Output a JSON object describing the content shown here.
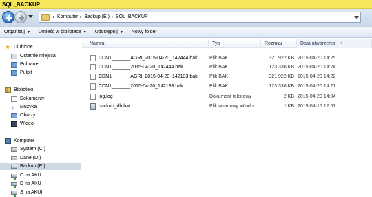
{
  "window": {
    "title": "SQL_BACKUP"
  },
  "address": {
    "crumbs": [
      "Komputer",
      "Backup (E:)",
      "SQL_BACKUP"
    ]
  },
  "toolbar": {
    "organize": "Organizuj",
    "share_library": "Umieść w bibliotece",
    "share": "Udostępnij",
    "new_folder": "Nowy folder"
  },
  "sidebar": {
    "favorites": "Ulubione",
    "recent": "Ostatnie miejsca",
    "downloads": "Pobrane",
    "desktop": "Pulpit",
    "libraries": "Biblioteki",
    "documents": "Dokumenty",
    "music": "Muzyka",
    "pictures": "Obrazy",
    "videos": "Wideo",
    "computer": "Komputer",
    "drives": [
      "System (C:)",
      "Dane (D:)",
      "Backup (E:)",
      "C na AKU",
      "D na AKU",
      "S na AKUI"
    ]
  },
  "columns": {
    "name": "Nazwa",
    "type": "Typ",
    "size": "Rozmiar",
    "date": "Data utworzenia"
  },
  "files": [
    {
      "name": "CDN1_______AGRI_2015-04-20_142444.bak",
      "type": "Plik BAK",
      "size": "321 922 KB",
      "date": "2015-04-20 14:25"
    },
    {
      "name": "CDN1_______2015-04-20_142444.bak",
      "type": "Plik BAK",
      "size": "123 336 KB",
      "date": "2015-04-20 14:24"
    },
    {
      "name": "CDN1_______AGRI_2015-04-20_142133.bak",
      "type": "Plik BAK",
      "size": "321 922 KB",
      "date": "2015-04-20 14:22"
    },
    {
      "name": "CDN1_______2015-04-20_142133.bak",
      "type": "Plik BAK",
      "size": "123 336 KB",
      "date": "2015-04-20 14:21"
    },
    {
      "name": "log.log",
      "type": "Dokument tekstowy",
      "size": "2 KB",
      "date": "2015-04-20 14:04"
    },
    {
      "name": "backup_db.bat",
      "type": "Plik wsadowy Windo...",
      "size": "1 KB",
      "date": "2015-04-15 12:51"
    }
  ]
}
